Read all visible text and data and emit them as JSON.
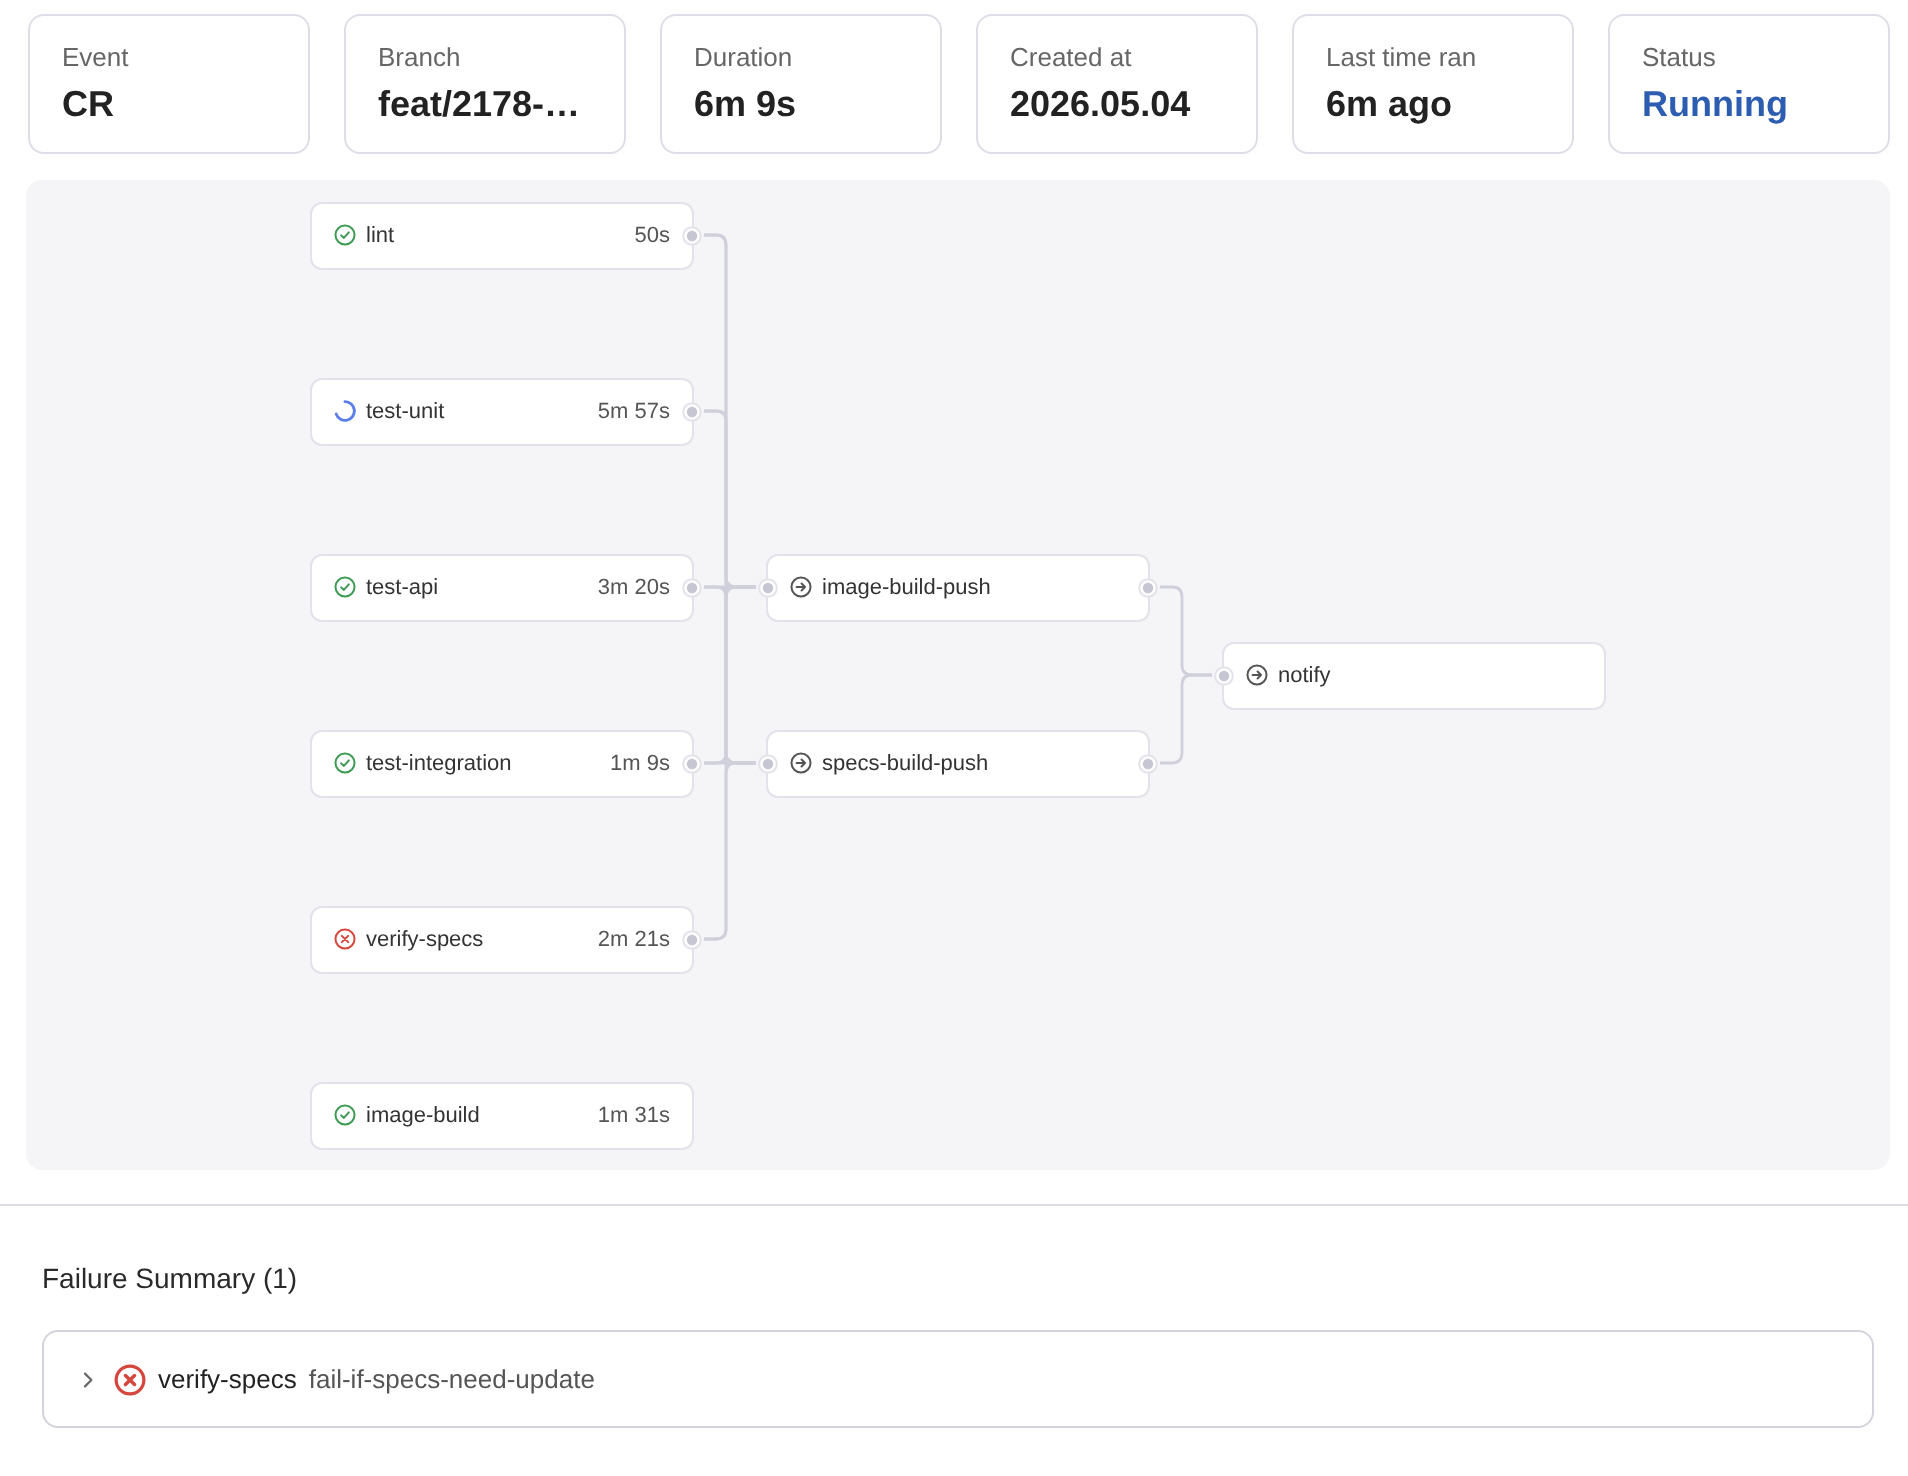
{
  "summary_cards": [
    {
      "label": "Event",
      "value": "CR",
      "kind": "text"
    },
    {
      "label": "Branch",
      "value": "feat/2178-…",
      "kind": "text"
    },
    {
      "label": "Duration",
      "value": "6m 9s",
      "kind": "text"
    },
    {
      "label": "Created at",
      "value": "2026.05.04",
      "kind": "text"
    },
    {
      "label": "Last time ran",
      "value": "6m ago",
      "kind": "text"
    },
    {
      "label": "Status",
      "value": "Running",
      "kind": "status"
    }
  ],
  "pipeline": {
    "stages": [
      {
        "jobs": [
          {
            "name": "lint",
            "duration": "50s",
            "kind": "success",
            "upstream": false,
            "downstream": true
          },
          {
            "name": "test-unit",
            "duration": "5m 57s",
            "kind": "running",
            "upstream": false,
            "downstream": true
          },
          {
            "name": "test-api",
            "duration": "3m 20s",
            "kind": "success",
            "upstream": false,
            "downstream": true
          },
          {
            "name": "test-integration",
            "duration": "1m 9s",
            "kind": "success",
            "upstream": false,
            "downstream": true
          },
          {
            "name": "verify-specs",
            "duration": "2m 21s",
            "kind": "failed",
            "upstream": false,
            "downstream": true
          },
          {
            "name": "image-build",
            "duration": "1m 31s",
            "kind": "success",
            "upstream": false,
            "downstream": false
          }
        ]
      },
      {
        "jobs": [
          {
            "name": "image-build-push",
            "kind": "pending",
            "upstream": true,
            "downstream": true
          },
          {
            "name": "specs-build-push",
            "kind": "pending",
            "upstream": true,
            "downstream": true
          }
        ]
      },
      {
        "jobs": [
          {
            "name": "notify",
            "kind": "pending",
            "upstream": true,
            "downstream": false
          }
        ]
      }
    ]
  },
  "failure_summary": {
    "title": "Failure Summary (1)",
    "items": [
      {
        "job": "verify-specs",
        "step": "fail-if-specs-need-update",
        "expanded": false
      }
    ]
  }
}
